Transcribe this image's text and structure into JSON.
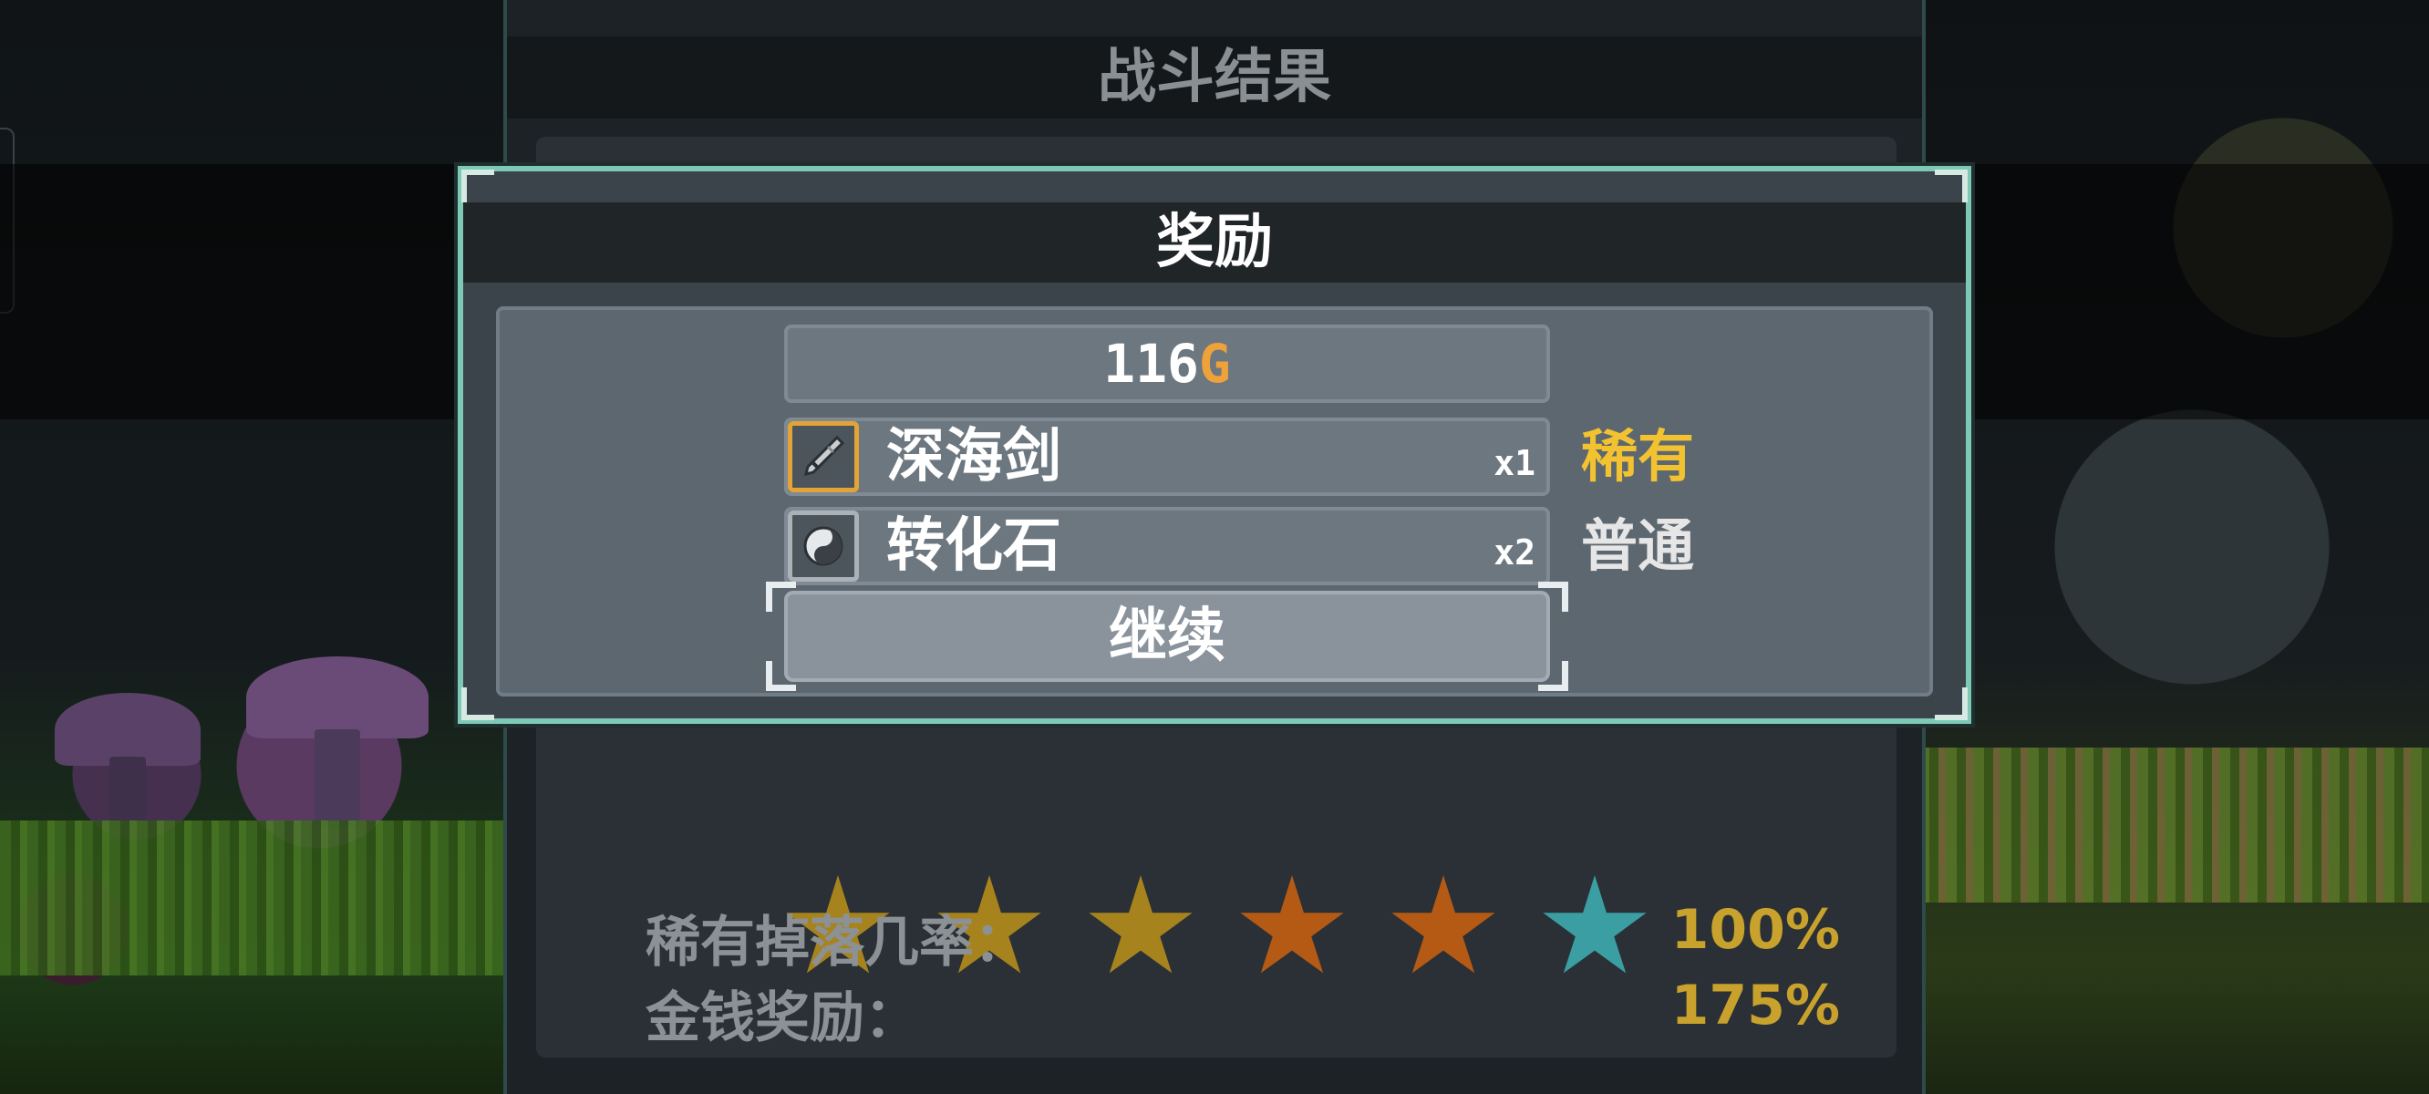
{
  "result_panel": {
    "title": "战斗结果",
    "stars": [
      {
        "icon": "star-icon",
        "color": "#a6831d"
      },
      {
        "icon": "star-icon",
        "color": "#a6831d"
      },
      {
        "icon": "star-icon",
        "color": "#a6831d"
      },
      {
        "icon": "star-icon",
        "color": "#b55a14"
      },
      {
        "icon": "star-icon",
        "color": "#b55a14"
      },
      {
        "icon": "star-icon",
        "color": "#3a9ea2"
      }
    ],
    "stats": [
      {
        "label": "稀有掉落几率：",
        "value": "100%"
      },
      {
        "label": "金钱奖励：",
        "value": "175%"
      }
    ]
  },
  "reward_dialog": {
    "title": "奖励",
    "gold": {
      "amount": "116",
      "unit": "G"
    },
    "items": [
      {
        "name": "深海剑",
        "qty": "x1",
        "rarity": "稀有",
        "rarity_color": "#f2c230",
        "icon": "sword-icon"
      },
      {
        "name": "转化石",
        "qty": "x2",
        "rarity": "普通",
        "rarity_color": "#e6e6e6",
        "icon": "stone-icon"
      }
    ],
    "continue_label": "继续"
  }
}
